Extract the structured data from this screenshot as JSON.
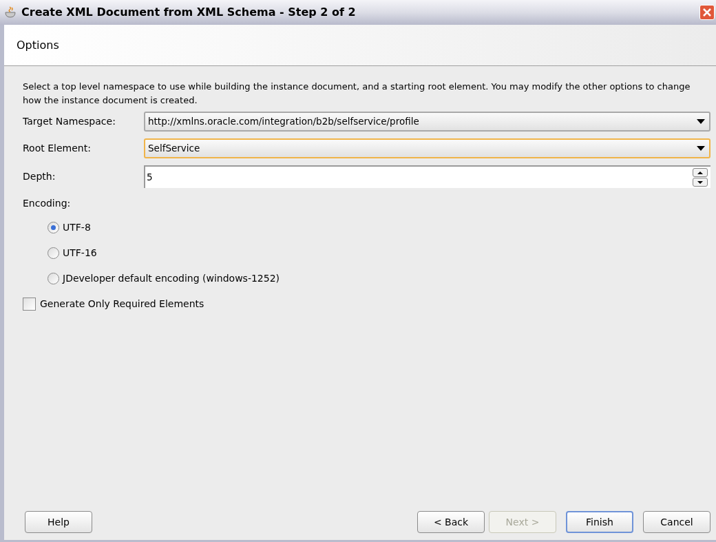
{
  "window": {
    "title": "Create XML Document from XML Schema - Step 2 of 2"
  },
  "header": {
    "title": "Options"
  },
  "description": "Select a top level namespace to use while building the instance document, and a starting root element. You may modify the other options to change how the instance document is created.",
  "fields": [
    {
      "kind": "dropdown",
      "label": "Target Namespace:",
      "value": "http://xmlns.oracle.com/integration/b2b/selfservice/profile",
      "focused": false
    },
    {
      "kind": "dropdown",
      "label": "Root Element:",
      "value": "SelfService",
      "focused": true
    },
    {
      "kind": "spinner",
      "label": "Depth:",
      "value": "5"
    }
  ],
  "encoding": {
    "label": "Encoding:",
    "options": [
      {
        "label": "UTF-8",
        "selected": true
      },
      {
        "label": "UTF-16",
        "selected": false
      },
      {
        "label": "JDeveloper default encoding (windows-1252)",
        "selected": false
      }
    ]
  },
  "generate_only_required": {
    "label": "Generate Only Required Elements",
    "checked": false
  },
  "help_button": {
    "label": "Help"
  },
  "buttons": [
    {
      "label": "< Back",
      "disabled": false,
      "default": false
    },
    {
      "label": "Next >",
      "disabled": true,
      "default": false
    },
    {
      "label": "Finish",
      "disabled": false,
      "default": true
    },
    {
      "label": "Cancel",
      "disabled": false,
      "default": false
    }
  ]
}
